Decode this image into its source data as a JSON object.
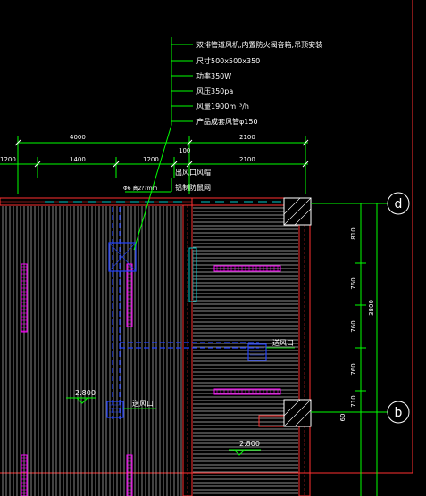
{
  "notes": {
    "line1": "双排管道风机,内置防火阀音箱,吊顶安装",
    "line2": "尺寸500x500x350",
    "line3": "功率350W",
    "line4": "风压350pa",
    "line5": "风量1900m",
    "line5_unit": "³/h",
    "line6": "产品成套风管φ150"
  },
  "dims": {
    "top_left": "4000",
    "top_right": "2100",
    "mid_100": "100",
    "row2_a": "1200",
    "row2_b": "1400",
    "row2_c": "1200",
    "row2_d": "2100",
    "right_810": "810",
    "right_760a": "760",
    "right_760b": "760",
    "right_760c": "760",
    "right_710": "710",
    "right_60": "60",
    "right_total": "3800"
  },
  "labels": {
    "outlet_cap": "出风口风帽",
    "mesh": "铝制防鼠网",
    "duct_size": "Φ6 高2??mm",
    "supply_outlet_right": "送风口",
    "supply_outlet_left": "送风口",
    "level_left": "2.800",
    "level_right": "2.800"
  },
  "axes": {
    "d": "d",
    "b": "b"
  },
  "colors": {
    "background": "#000000",
    "dim_green": "#00ff00",
    "text_white": "#ffffff",
    "wall_red": "#ff3030",
    "hatch_gray": "#cfcfcf",
    "duct_blue": "#2040ff",
    "fixture_magenta": "#ff00ff",
    "teal": "#00c8c8"
  }
}
